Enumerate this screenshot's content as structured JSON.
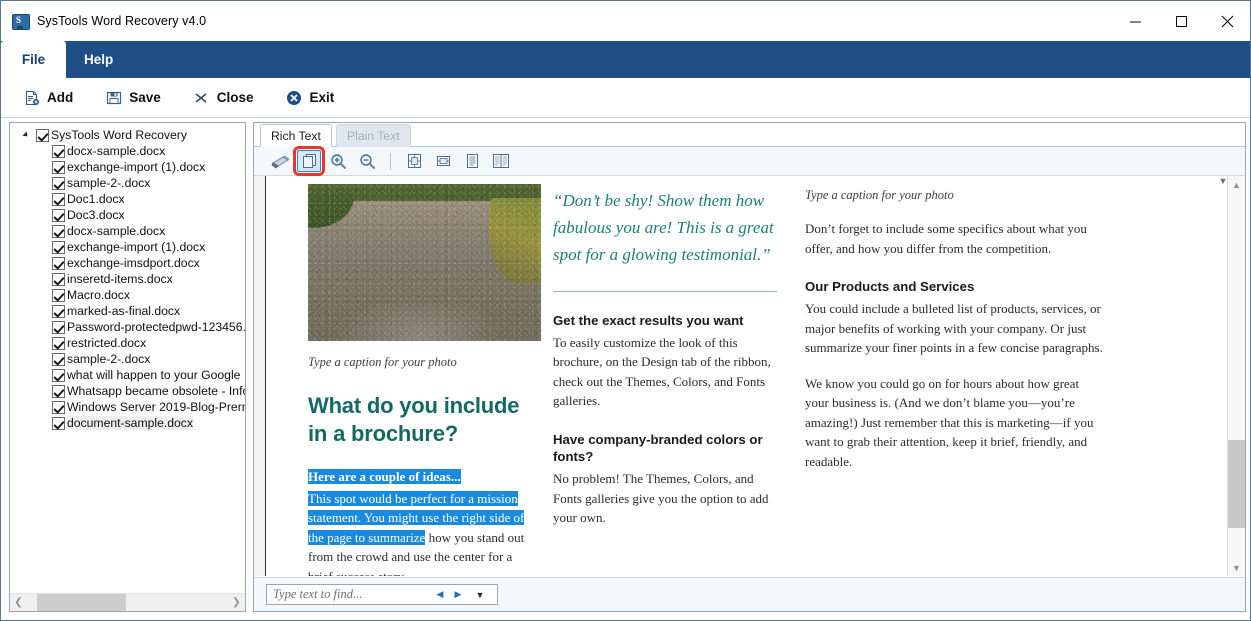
{
  "window": {
    "title": "SysTools Word Recovery v4.0",
    "app_icon": "systools-icon",
    "minimize": "minimize-icon",
    "maximize": "maximize-icon",
    "close": "close-icon"
  },
  "ribbon": {
    "tabs": [
      {
        "label": "File",
        "active": true
      },
      {
        "label": "Help",
        "active": false
      }
    ],
    "items": [
      {
        "label": "Add",
        "icon": "add-document-icon"
      },
      {
        "label": "Save",
        "icon": "floppy-disk-icon"
      },
      {
        "label": "Close",
        "icon": "x-icon"
      },
      {
        "label": "Exit",
        "icon": "exit-circle-icon"
      }
    ]
  },
  "tree": {
    "root": {
      "label": "SysTools Word Recovery",
      "checked": true,
      "expanded": true
    },
    "items": [
      {
        "label": "docx-sample.docx",
        "checked": true
      },
      {
        "label": "exchange-import (1).docx",
        "checked": true
      },
      {
        "label": "sample-2-.docx",
        "checked": true
      },
      {
        "label": "Doc1.docx",
        "checked": true
      },
      {
        "label": "Doc3.docx",
        "checked": true
      },
      {
        "label": "docx-sample.docx",
        "checked": true
      },
      {
        "label": "exchange-import (1).docx",
        "checked": true
      },
      {
        "label": "exchange-imsdport.docx",
        "checked": true
      },
      {
        "label": "inseretd-items.docx",
        "checked": true
      },
      {
        "label": "Macro.docx",
        "checked": true
      },
      {
        "label": "marked-as-final.docx",
        "checked": true
      },
      {
        "label": "Password-protectedpwd-123456.",
        "checked": true
      },
      {
        "label": "restricted.docx",
        "checked": true
      },
      {
        "label": "sample-2-.docx",
        "checked": true
      },
      {
        "label": "what will happen to your Google",
        "checked": true
      },
      {
        "label": "Whatsapp became obsolete - Info",
        "checked": true
      },
      {
        "label": "Windows Server 2019-Blog-Prern",
        "checked": true
      },
      {
        "label": "document-sample.docx",
        "checked": true,
        "selected": true
      }
    ],
    "hscroll": {
      "left_arrow": "chevron-left-icon",
      "right_arrow": "chevron-right-icon"
    }
  },
  "viewer": {
    "tabs": [
      {
        "label": "Rich Text",
        "active": true
      },
      {
        "label": "Plain Text",
        "active": false
      }
    ],
    "toolbar": [
      {
        "name": "print-icon",
        "selected": false
      },
      {
        "name": "copy-pages-icon",
        "selected": true
      },
      {
        "name": "zoom-in-icon",
        "selected": false
      },
      {
        "name": "zoom-out-icon",
        "selected": false
      },
      {
        "name": "fit-page-icon",
        "selected": false
      },
      {
        "name": "fit-width-icon",
        "selected": false
      },
      {
        "name": "single-page-icon",
        "selected": false
      },
      {
        "name": "two-page-icon",
        "selected": false
      }
    ],
    "find": {
      "placeholder": "Type text to find...",
      "value": "",
      "prev": "find-prev-icon",
      "next": "find-next-icon",
      "dropdown": "find-options-icon"
    }
  },
  "document": {
    "column1": {
      "photo_alt": "gravel-road-photo",
      "caption": "Type a caption for your photo",
      "heading": "What do you include in a brochure?",
      "highlight_lead": "Here are a couple of ideas...",
      "highlight_body": "This spot would be perfect for a mission statement. You might use the right side of the page to summarize",
      "rest_body": " how you stand out from the crowd and use the center for a brief success story."
    },
    "column2": {
      "quote": "“Don’t be shy! Show them how fabulous you are! This is a great spot for a glowing testimonial.”",
      "section1_heading": "Get the exact results you want",
      "section1_body": "To easily customize the look of this brochure, on the Design tab of the ribbon, check out the Themes, Colors, and Fonts galleries.",
      "section2_heading": "Have company-branded colors or fonts?",
      "section2_body": "No problem! The Themes, Colors, and Fonts galleries give you the option to add your own."
    },
    "column3": {
      "caption": "Type a caption for your photo",
      "intro_body": "Don’t forget to include some specifics about what you offer, and how you differ from the competition.",
      "section_heading": "Our Products and Services",
      "section_body1": "You could include a bulleted list of products, services, or major benefits of working with your company. Or just summarize your finer points in a few concise paragraphs.",
      "section_body2": "We know you could go on for hours about how great your business is. (And we don’t blame you—you’re amazing!) Just remember that this is marketing—if you want to grab their attention, keep it brief, friendly, and readable."
    }
  },
  "colors": {
    "ribbon_blue": "#1f4e86",
    "heading_teal": "#136a63",
    "quote_teal": "#1b7f78",
    "highlight_blue": "#1a8ade",
    "selection_red": "#e8352e"
  }
}
